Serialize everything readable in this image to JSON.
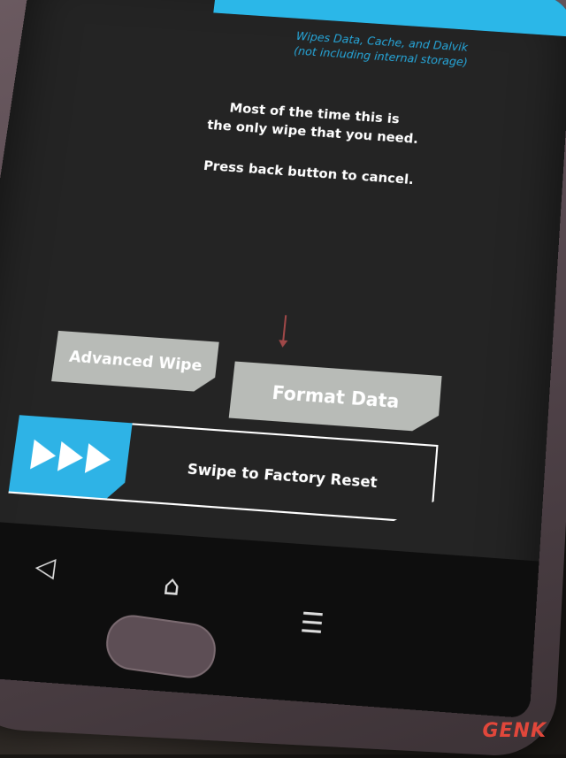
{
  "screen": {
    "header_line1": "Wipes Data, Cache, and Dalvik",
    "header_line2": "(not including internal storage)",
    "message_line1": "Most of the time this is",
    "message_line2": "the only wipe that you need.",
    "message_line3": "Press back button to cancel."
  },
  "buttons": {
    "advanced_wipe": "Advanced Wipe",
    "format_data": "Format Data"
  },
  "swipe": {
    "label": "Swipe to Factory Reset",
    "handle_color": "#2eb3e6"
  },
  "nav": {
    "back_icon": "◁",
    "home_icon": "⌂",
    "menu_icon": "☰"
  },
  "watermark": {
    "text": "GEN",
    "accent": "K"
  },
  "colors": {
    "accent_blue": "#2bb7e8",
    "button_gray": "#b8bbb7",
    "arrow_red": "#a04848"
  }
}
